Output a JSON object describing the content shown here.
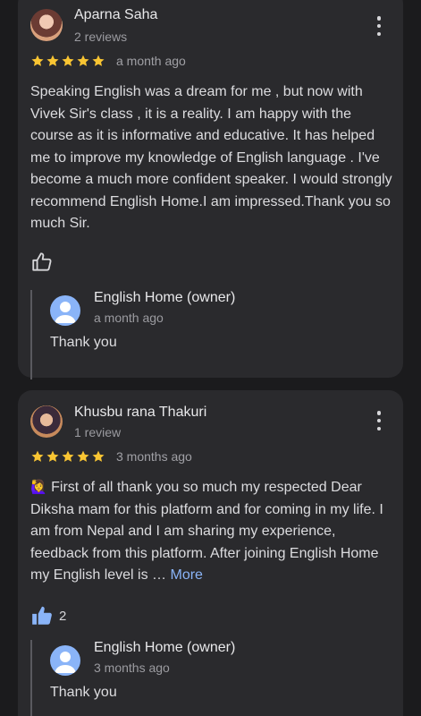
{
  "reviews": [
    {
      "author": "Aparna Saha",
      "review_count": "2 reviews",
      "rating": 5,
      "time": "a month ago",
      "text": "Speaking English was a dream for me , but now with Vivek Sir's class , it is a reality. I am happy with the course as it is informative and educative. It has helped me to improve my knowledge of English language . I've become a much more confident speaker. I would strongly recommend English Home.I am impressed.Thank you so much Sir.",
      "likes": "",
      "reply": {
        "owner": "English Home (owner)",
        "time": "a month ago",
        "text": "Thank you"
      }
    },
    {
      "author": "Khusbu rana Thakuri",
      "review_count": "1 review",
      "rating": 5,
      "time": "3 months ago",
      "emoji": "🙋‍♀️",
      "text": " First of all thank you so much my respected Dear Diksha mam for this platform and for coming in my life. I am from Nepal and I am sharing my experience, feedback from this platform. After joining English Home my English level is … ",
      "more_label": "More",
      "likes": "2",
      "reply": {
        "owner": "English Home (owner)",
        "time": "3 months ago",
        "text": "Thank you"
      }
    }
  ],
  "colors": {
    "star": "#f9c533",
    "link": "#8ab4f8",
    "like_filled": "#8ab4f8",
    "card": "#2a2a2d"
  },
  "icons": [
    "more-vert-icon",
    "star-icon",
    "thumb-up-outline-icon",
    "thumb-up-filled-icon",
    "person-icon"
  ]
}
